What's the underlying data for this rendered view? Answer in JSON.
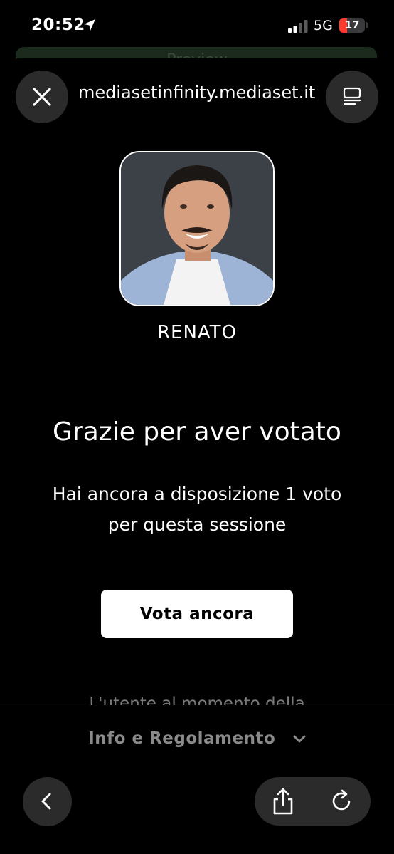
{
  "status_bar": {
    "time": "20:52",
    "network": "5G",
    "battery_level": "17",
    "battery_color": "#ff3b30",
    "icons": [
      "location-arrow-icon",
      "signal-icon",
      "battery-icon"
    ]
  },
  "background_card": {
    "text": "Preview"
  },
  "browser": {
    "url": "mediasetinfinity.mediaset.it",
    "close_icon": "close-icon",
    "menu_icon": "reader-menu-icon"
  },
  "candidate": {
    "name": "RENATO",
    "photo_icon": "candidate-photo"
  },
  "confirmation": {
    "title": "Grazie per aver votato",
    "subtitle_line1": "Hai ancora a disposizione 1 voto",
    "subtitle_line2": "per questa sessione",
    "vote_button_label": "Vota ancora"
  },
  "partial_text": "L'utente al momento della",
  "info": {
    "label": "Info e Regolamento",
    "icon": "chevron-down-icon"
  },
  "toolbar": {
    "back_icon": "chevron-left-icon",
    "share_icon": "share-icon",
    "reload_icon": "reload-icon"
  }
}
